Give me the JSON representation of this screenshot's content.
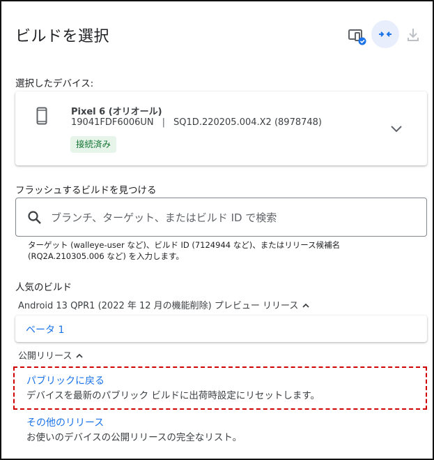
{
  "header": {
    "title": "ビルドを選択",
    "icons": [
      "device-status-icon",
      "sync-icon",
      "download-icon"
    ]
  },
  "device_section": {
    "label": "選択したデバイス:",
    "device": {
      "name": "Pixel 6 (オリオール)",
      "serial": "19041FDF6006UN",
      "separator": "|",
      "build": "SQ1D.220205.004.X2 (8978748)",
      "status": "接続済み"
    }
  },
  "search": {
    "label": "フラッシュするビルドを見つける",
    "placeholder": "ブランチ、ターゲット、またはビルド ID で検索",
    "value": "",
    "hint": "ターゲット (walleye-user など)、ビルド ID (7124944 など)、またはリリース候補名 (RQ2A.210305.006 など) を入力します。"
  },
  "popular": {
    "label": "人気のビルド",
    "groups": [
      {
        "title": "Android 13 QPR1 (2022 年 12 月の機能削除) プレビュー リリース",
        "items": [
          {
            "title": "ベータ 1"
          }
        ]
      },
      {
        "title": "公開リリース",
        "items": [
          {
            "title": "パブリックに戻る",
            "description": "デバイスを最新のパブリック ビルドに出荷時設定にリセットします。"
          },
          {
            "title": "その他のリリース",
            "description": "お使いのデバイスの公開リリースの完全なリスト。"
          }
        ]
      }
    ]
  },
  "colors": {
    "accent": "#1a73e8",
    "status_bg": "#e6f4ea",
    "status_text": "#137333",
    "highlight_border": "#d10000"
  }
}
